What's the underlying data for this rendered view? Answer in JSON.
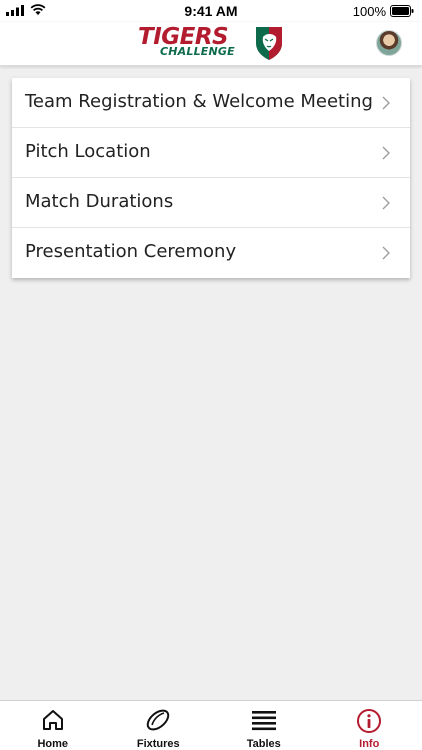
{
  "status_bar": {
    "time": "9:41 AM",
    "battery_percent": "100%"
  },
  "header": {
    "logo_line1": "TIGERS",
    "logo_line2": "CHALLENGE",
    "brand_red": "#b31b2e",
    "brand_green": "#0d6b4b"
  },
  "menu": {
    "items": [
      {
        "label": "Team Registration & Welcome Meeting"
      },
      {
        "label": "Pitch Location"
      },
      {
        "label": "Match Durations"
      },
      {
        "label": "Presentation Ceremony"
      }
    ]
  },
  "tab_bar": {
    "active_color": "#b31b2e",
    "tabs": [
      {
        "label": "Home",
        "icon": "home-icon"
      },
      {
        "label": "Fixtures",
        "icon": "rugby-ball-icon"
      },
      {
        "label": "Tables",
        "icon": "list-icon"
      },
      {
        "label": "Info",
        "icon": "info-icon",
        "active": true
      }
    ]
  }
}
